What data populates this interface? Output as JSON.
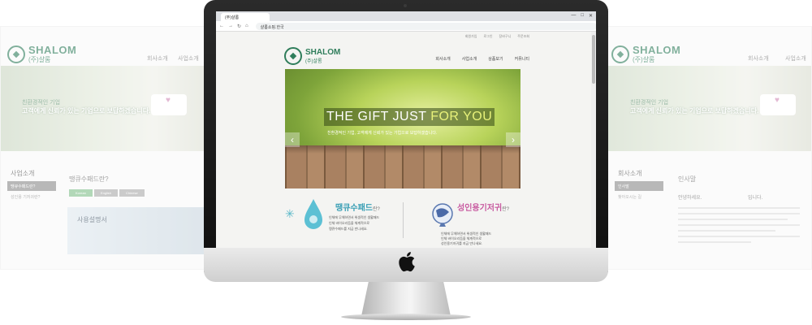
{
  "ghost_left": {
    "logo_en": "SHALOM",
    "logo_ko": "(주)샬롬",
    "nav": [
      "회사소개",
      "사업소개"
    ],
    "banner_line1": "친환경적인 기업",
    "banner_line2": "고객에게 신뢰가 있는 기업으로 보답하겠습니다.",
    "side_title": "사업소개",
    "side_active": "땡큐수패드란?",
    "side_item": "성인용 기저귀란?",
    "heading": "땡큐수패드란?",
    "tabs": [
      "Korean",
      "English",
      "Chinese"
    ],
    "photo_caption": "사용설명서"
  },
  "ghost_right": {
    "logo_en": "SHALOM",
    "logo_ko": "(주)샬롬",
    "nav": [
      "회사소개",
      "사업소개"
    ],
    "banner_line1": "친환경적인 기업",
    "banner_line2": "고객에게 신뢰가 있는 기업으로 보답하겠습니다.",
    "side_title": "회사소개",
    "side_active": "인사말",
    "side_item": "찾아오시는 길",
    "heading": "인사말",
    "greeting": "안녕하세요.",
    "greeting_end": "입니다."
  },
  "browser": {
    "tab_title": "(주)샬롬",
    "url": "샬롬쇼핑.한국",
    "window_buttons": [
      "—",
      "□",
      "✕"
    ]
  },
  "site": {
    "logo_en": "SHALOM",
    "logo_ko": "(주)샬롬",
    "util_links": [
      "회원가입",
      "로그인",
      "장바구니",
      "주문조회"
    ],
    "nav": [
      "회사소개",
      "사업소개",
      "상품보기",
      "커뮤니티"
    ],
    "hero_title_a": "THE GIFT JUST ",
    "hero_title_b": "FOR YOU",
    "hero_sub": "친환경적인 기업, 고객에게 신뢰가 있는 기업으로 보답하겠습니다.",
    "product1": {
      "title": "땡큐수패드",
      "suffix": "란?",
      "lines": [
        "인체에 무해하면서 위생적인 생활패드",
        "인체 바이오리듬을 체계적으로",
        "땡큐수패드를 지금 만나세요."
      ]
    },
    "product2": {
      "title": "성인용기저귀",
      "suffix": "란?",
      "lines": [
        "인체에 무해하면서 위생적인 생활패드",
        "인체 바이오리듬을 체계적으로",
        "성인용기저귀를 지금 만나세요."
      ]
    }
  },
  "colors": {
    "brand_green": "#2f7d5b",
    "product1_blue": "#3a9fb5",
    "product2_pink": "#c85aa0",
    "hero_highlight": "#e8f27a"
  }
}
